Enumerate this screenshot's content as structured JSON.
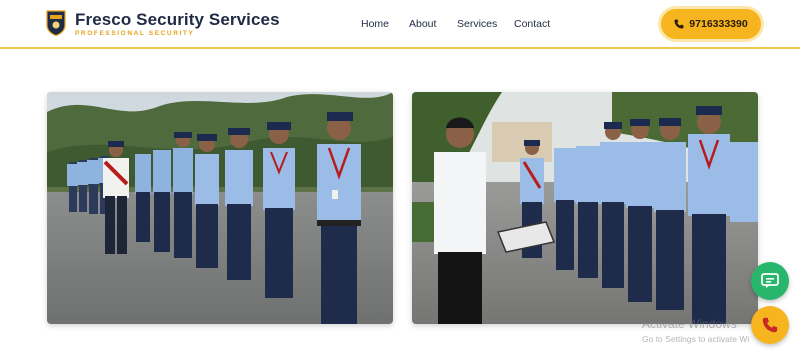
{
  "header": {
    "brand_name": "Fresco Security Services",
    "brand_tagline": "PROFESSIONAL SECURITY",
    "nav": [
      {
        "label": "Home"
      },
      {
        "label": "About"
      },
      {
        "label": "Services"
      },
      {
        "label": "Contact"
      }
    ],
    "phone_label": "9716333390"
  },
  "gallery": [
    {
      "name": "guards-lineup-photo",
      "icon": "photo-guards-in-line"
    },
    {
      "name": "supervisor-briefing-photo",
      "icon": "photo-supervisor-with-clipboard"
    }
  ],
  "floating": {
    "chat_icon": "chat-bubble-icon",
    "call_icon": "phone-icon"
  },
  "watermark": {
    "line1": "Activate Windows",
    "line2": "Go to Settings to activate Wi"
  },
  "colors": {
    "accent": "#f6b51e",
    "navy": "#1f2a44",
    "chat_green": "#27b66b",
    "tagline": "#e6a21c"
  }
}
